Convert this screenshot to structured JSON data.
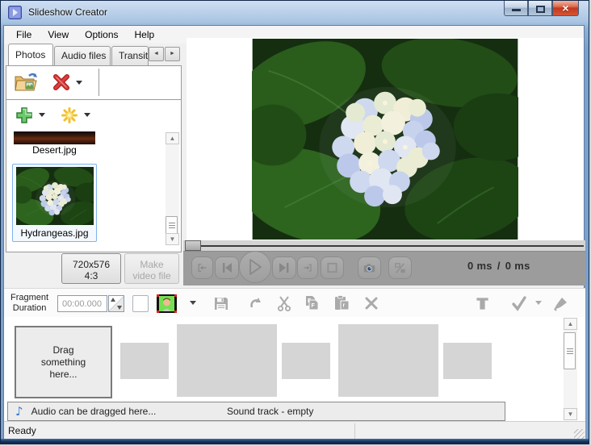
{
  "window": {
    "title": "Slideshow Creator"
  },
  "menu": {
    "items": [
      "File",
      "View",
      "Options",
      "Help"
    ]
  },
  "tabs": {
    "items": [
      "Photos",
      "Audio files",
      "Transiti"
    ],
    "active": "Photos"
  },
  "photos": {
    "items": [
      {
        "label": "Desert.jpg"
      },
      {
        "label": "Hydrangeas.jpg",
        "selected": true
      }
    ]
  },
  "output": {
    "resolution": "720x576",
    "aspect": "4:3",
    "make_line1": "Make",
    "make_line2": "video file"
  },
  "player": {
    "elapsed": "0 ms",
    "divider": "/",
    "total": "0 ms"
  },
  "fragment": {
    "label_line1": "Fragment",
    "label_line2": "Duration",
    "duration": "00:00.000"
  },
  "timeline": {
    "drop_hint_line1": "Drag",
    "drop_hint_line2": "something here..."
  },
  "audio": {
    "drop_hint": "Audio can be dragged here...",
    "track_status": "Sound track - empty"
  },
  "statusbar": {
    "text": "Ready"
  },
  "icons": {
    "toolbar": [
      "open-folder",
      "delete-red-x",
      "add-plus",
      "effects-burst"
    ],
    "player": [
      "go-start",
      "previous",
      "play",
      "next",
      "go-end",
      "stop",
      "snapshot-camera",
      "zoom-ratio"
    ],
    "fragment_row": [
      "chroma-key-face",
      "save",
      "undo",
      "cut",
      "copy",
      "paste",
      "delete-x",
      "text",
      "check",
      "brush"
    ],
    "audio": "music-note"
  },
  "colors": {
    "titlebar_top": "#cfdff2",
    "titlebar_bottom": "#7da0cb",
    "close_red": "#c13a1f",
    "selection_blue": "#7eb4ea",
    "controlbar_gray": "#9c9c9c",
    "folder_yellow": "#f0c36d",
    "delete_red": "#cc2222",
    "add_green": "#4caf50",
    "burst_gold": "#f0c030",
    "chroma_green": "#6ee04a",
    "note_blue": "#3a7ad0"
  }
}
